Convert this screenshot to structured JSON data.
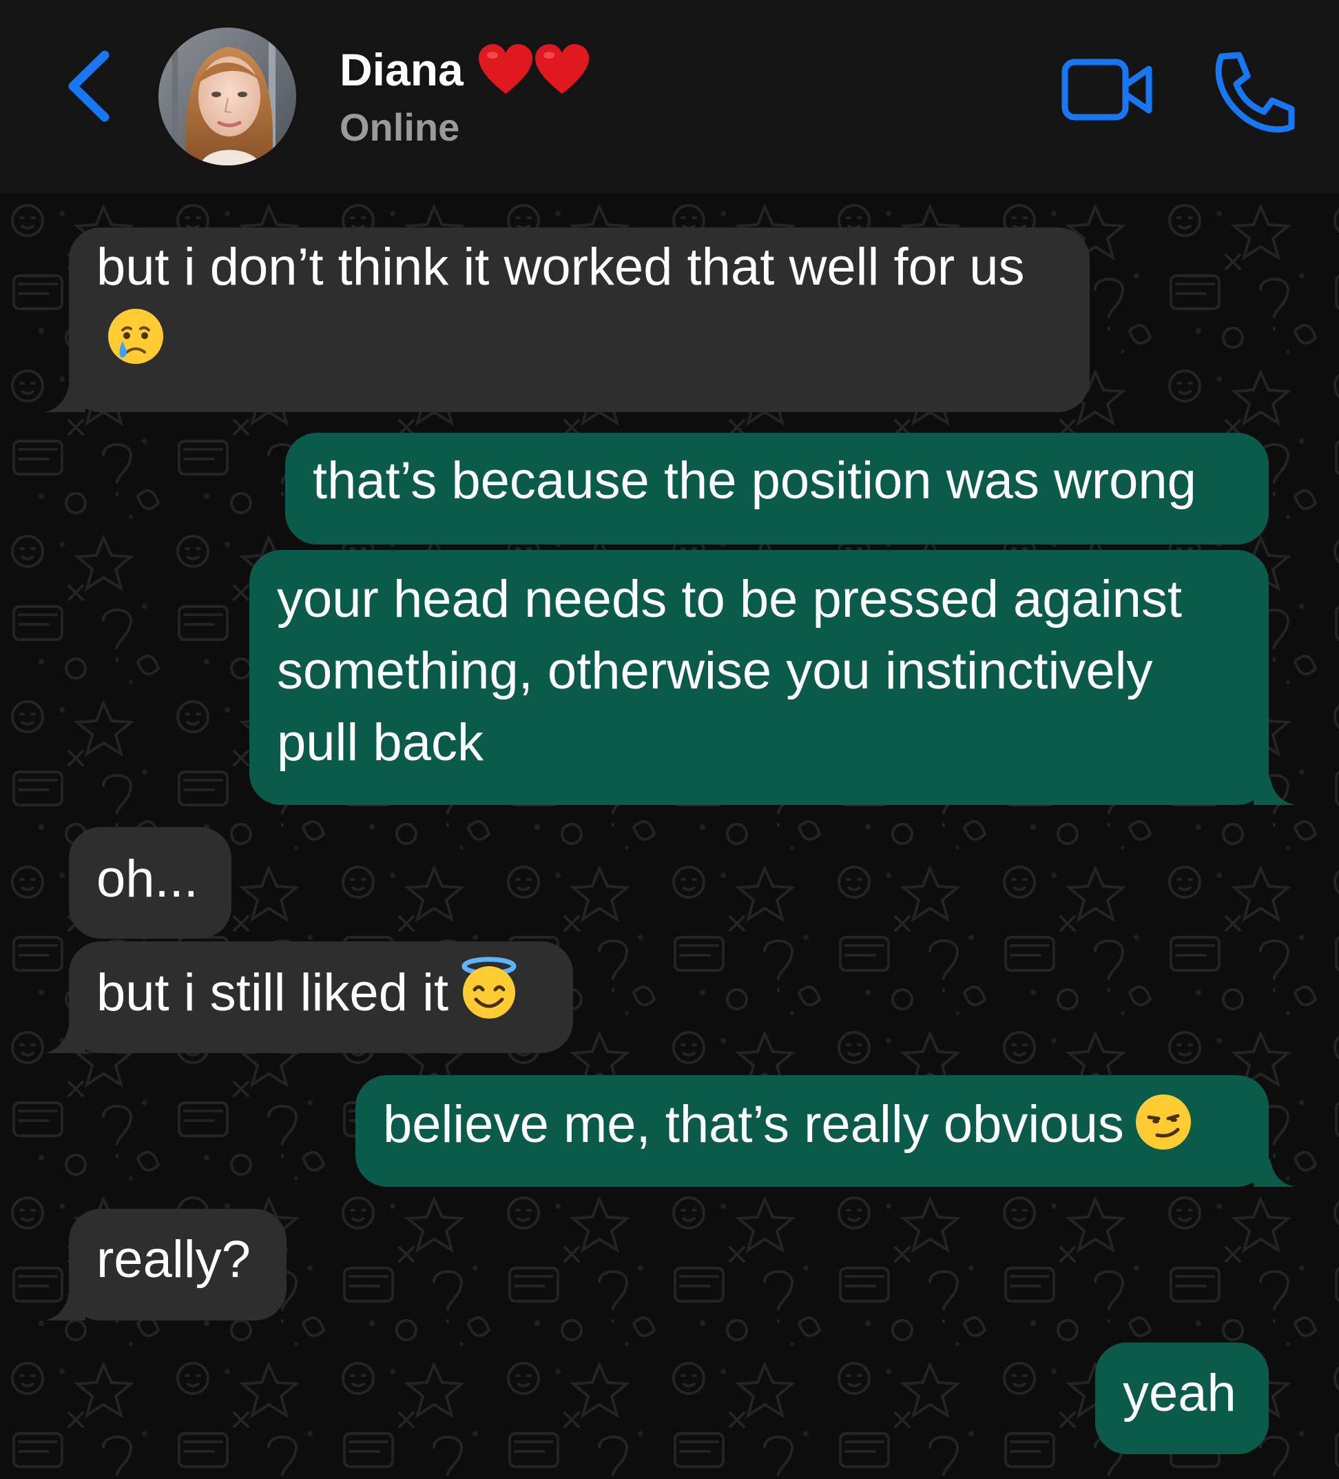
{
  "header": {
    "contact_name": "Diana",
    "name_emoji": [
      "red-heart",
      "red-heart"
    ],
    "status": "Online",
    "icons": {
      "back": "chevron-left-icon",
      "video": "video-camera-icon",
      "call": "phone-icon"
    },
    "accent_color": "#1877f2"
  },
  "colors": {
    "incoming_bubble": "#2e2e2e",
    "outgoing_bubble": "#0b5b4a",
    "header_bg": "#141414",
    "chat_bg": "#0d0d0d"
  },
  "messages": [
    {
      "direction": "incoming",
      "text": "but i don’t think it worked that well for us",
      "emoji": "crying-face"
    },
    {
      "direction": "outgoing",
      "text": "that’s because the position was wrong"
    },
    {
      "direction": "outgoing",
      "text": "your head needs to be pressed against something, otherwise you instinctively pull back"
    },
    {
      "direction": "incoming",
      "text": "oh..."
    },
    {
      "direction": "incoming",
      "text": "but i still liked it",
      "emoji": "smiling-face-with-halo"
    },
    {
      "direction": "outgoing",
      "text": "believe me, that’s really obvious",
      "emoji": "smirking-face"
    },
    {
      "direction": "incoming",
      "text": "really?"
    },
    {
      "direction": "outgoing",
      "text": "yeah"
    }
  ]
}
